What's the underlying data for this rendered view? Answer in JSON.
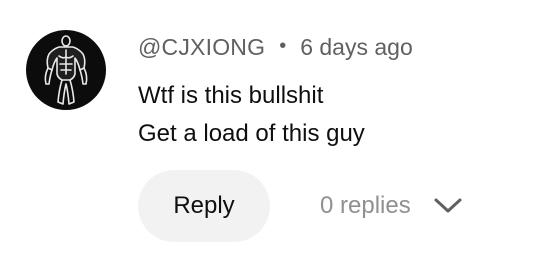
{
  "comment": {
    "author": "@CJXIONG",
    "separator": "•",
    "timestamp": "6 days ago",
    "lines": [
      "Wtf is this bullshit",
      "Get a load of this guy"
    ],
    "avatar_icon": "muscular-figure-avatar-icon",
    "reply_label": "Reply",
    "replies_label": "0 replies",
    "replies_toggle_icon": "chevron-down-icon"
  },
  "colors": {
    "primary_text": "#0f0f0f",
    "secondary_text": "#606060",
    "muted_text": "#909090",
    "button_bg": "#f2f2f2",
    "avatar_bg": "#0c0c0c"
  }
}
